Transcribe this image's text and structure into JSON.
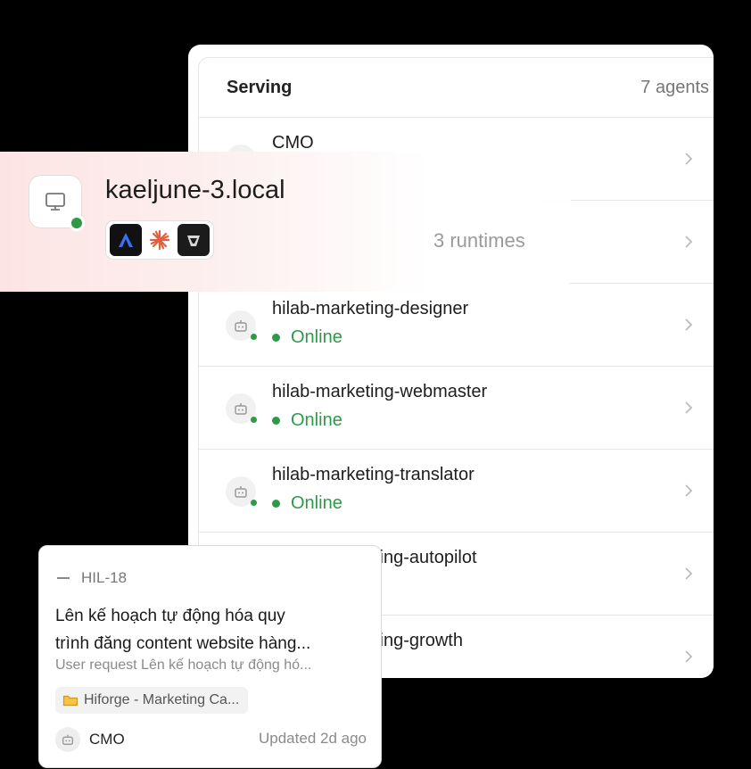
{
  "serving": {
    "title": "Serving",
    "count": "7 agents",
    "agents": [
      {
        "name": "CMO",
        "status": ""
      },
      {
        "name": "",
        "status": ""
      },
      {
        "name": "hilab-marketing-designer",
        "status": "Online"
      },
      {
        "name": "hilab-marketing-webmaster",
        "status": "Online"
      },
      {
        "name": "hilab-marketing-translator",
        "status": "Online"
      },
      {
        "name": "ting-autopilot",
        "status": ""
      },
      {
        "name": "ting-growth",
        "status": ""
      }
    ]
  },
  "machine": {
    "hostname": "kaeljune-3.local",
    "runtimes_label": "3 runtimes",
    "runtime_icons": [
      "arrow-runtime-icon",
      "starburst-runtime-icon",
      "cube-runtime-icon"
    ],
    "status_color": "#2e9a48"
  },
  "issue": {
    "id": "HIL-18",
    "title_line1": "Lên kế hoạch tự động hóa quy",
    "title_line2": "trình đăng content website hàng...",
    "description": "User request Lên kế hoạch tự động hó...",
    "project": "Hiforge - Marketing Ca...",
    "assignee": "CMO",
    "updated": "Updated 2d ago"
  },
  "colors": {
    "online": "#2e9a48",
    "accent_pink": "#fde4e4"
  }
}
